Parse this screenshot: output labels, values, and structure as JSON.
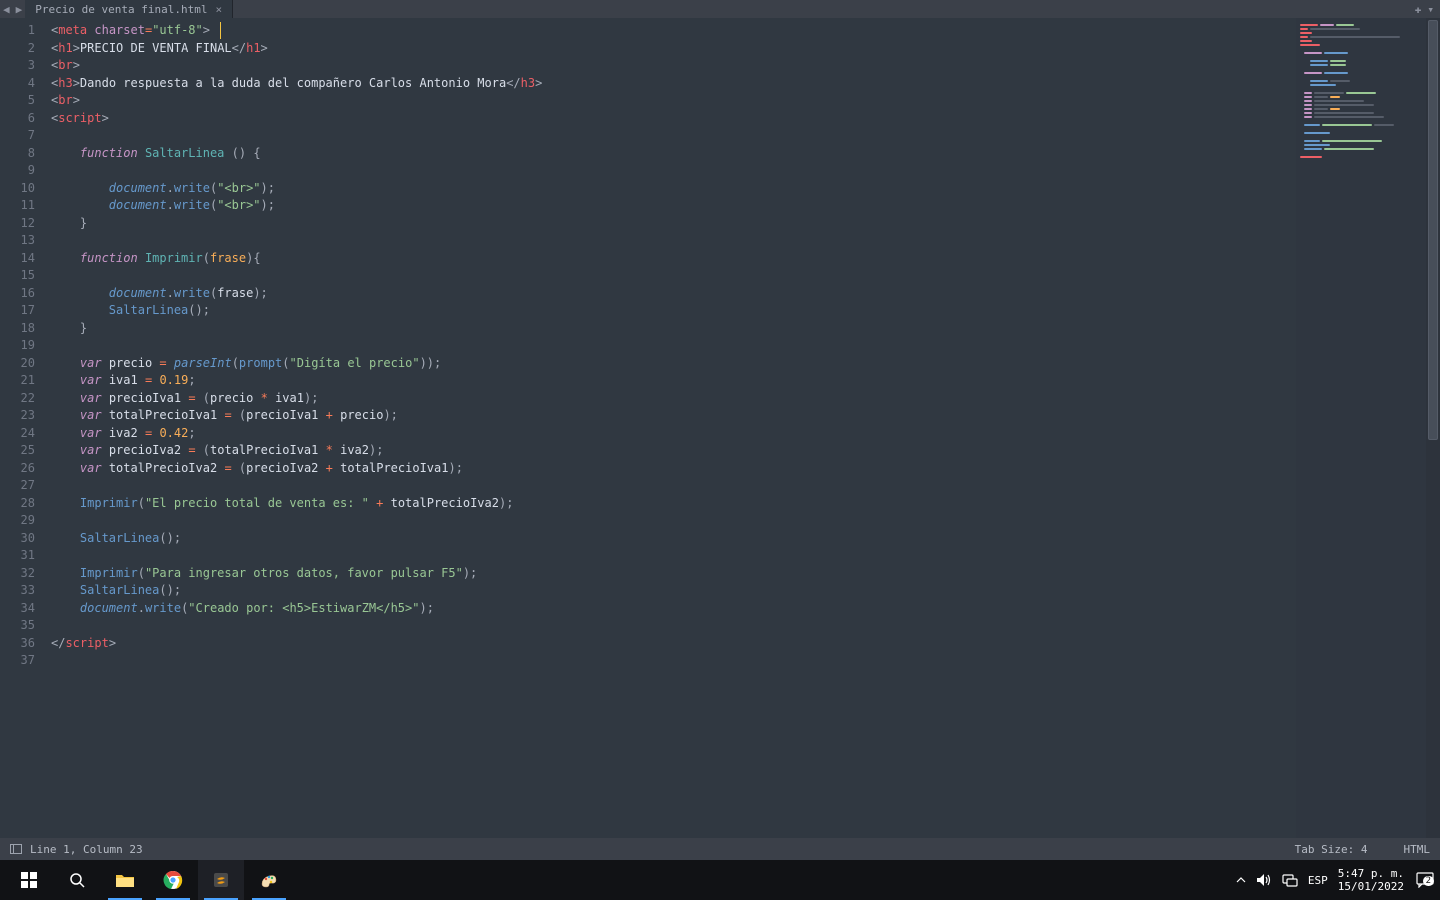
{
  "tabbar": {
    "tab_title": "Precio de venta final.html",
    "arrow_left": "◀",
    "arrow_right": "▶",
    "add": "✚",
    "menu": "▾"
  },
  "code": {
    "line_numbers": [
      "1",
      "2",
      "3",
      "4",
      "5",
      "6",
      "7",
      "8",
      "9",
      "10",
      "11",
      "12",
      "13",
      "14",
      "15",
      "16",
      "17",
      "18",
      "19",
      "20",
      "21",
      "22",
      "23",
      "24",
      "25",
      "26",
      "27",
      "28",
      "29",
      "30",
      "31",
      "32",
      "33",
      "34",
      "35",
      "36",
      "37"
    ],
    "charset_value": "\"utf-8\"",
    "h1_text": "PRECIO DE VENTA FINAL",
    "h3_text": "Dando respuesta a la duda del compañero Carlos Antonio Mora",
    "fn_saltar": "SaltarLinea",
    "fn_imprimir": "Imprimir",
    "param_frase": "frase",
    "doc_write_br": "\"<br>\"",
    "prompt_str": "\"Digíta el precio\"",
    "iva1_val": "0.19",
    "iva2_val": "0.42",
    "msg_total": "\"El precio total de venta es: \"",
    "msg_f5": "\"Para ingresar otros datos, favor pulsar F5\"",
    "creado": "\"Creado por: <h5>EstiwarZM</h5>\"",
    "ids": {
      "document": "document",
      "write": "write",
      "parseInt": "parseInt",
      "prompt": "prompt",
      "precio": "precio",
      "iva1": "iva1",
      "iva2": "iva2",
      "precioIva1": "precioIva1",
      "precioIva2": "precioIva2",
      "totalPrecioIva1": "totalPrecioIva1",
      "totalPrecioIva2": "totalPrecioIva2"
    }
  },
  "statusbar": {
    "position": "Line 1, Column 23",
    "tab_size": "Tab Size: 4",
    "lang": "HTML"
  },
  "taskbar": {
    "lang": "ESP",
    "time": "5:47 p. m.",
    "date": "15/01/2022",
    "notif_count": "2"
  }
}
